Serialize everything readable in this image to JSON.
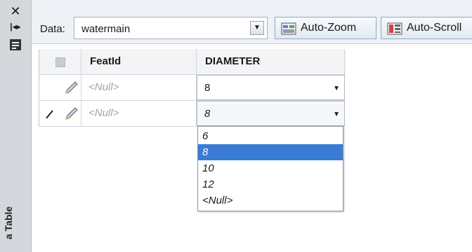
{
  "side_panel": {
    "title": "a Table",
    "icons": [
      "close-icon",
      "dock-icon",
      "properties-icon"
    ]
  },
  "toolbar": {
    "data_label": "Data:",
    "data_value": "watermain",
    "auto_zoom_label": "Auto-Zoom",
    "auto_scroll_label": "Auto-Scroll"
  },
  "table": {
    "columns": [
      "FeatId",
      "DIAMETER"
    ],
    "rows": [
      {
        "featid": "<Null>",
        "diameter": "8"
      },
      {
        "featid": "<Null>",
        "diameter": "8"
      }
    ]
  },
  "dropdown": {
    "options": [
      "6",
      "8",
      "10",
      "12",
      "<Null>"
    ],
    "selected": "8"
  },
  "colors": {
    "selection": "#3a7bd5",
    "toolbar": "#eef1f5"
  }
}
